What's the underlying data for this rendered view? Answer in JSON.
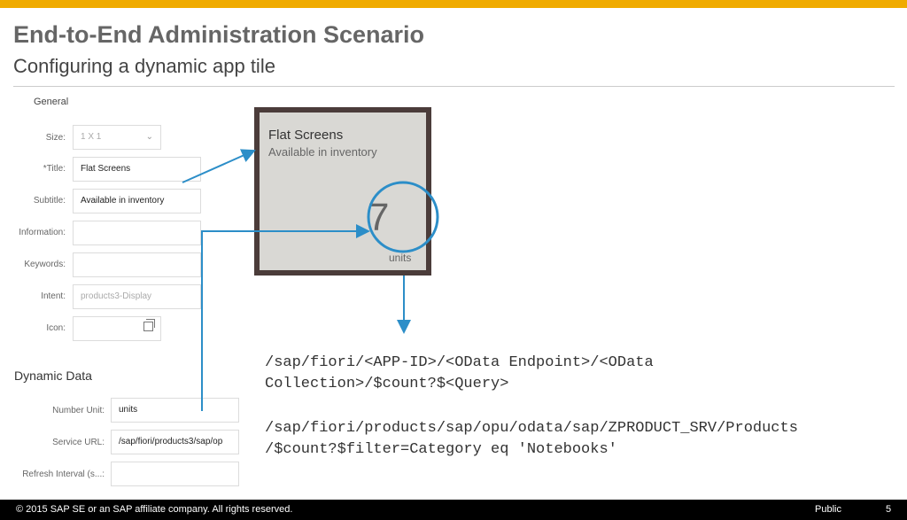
{
  "header": {
    "title": "End-to-End Administration Scenario",
    "subtitle": "Configuring a dynamic app tile"
  },
  "form": {
    "general_title": "General",
    "size_label": "Size:",
    "size_value": "1 X 1",
    "title_label": "*Title:",
    "title_value": "Flat Screens",
    "subtitle_label": "Subtitle:",
    "subtitle_value": "Available in inventory",
    "information_label": "Information:",
    "keywords_label": "Keywords:",
    "intent_label": "Intent:",
    "intent_value": "products3-Display",
    "icon_label": "Icon:",
    "dynamic_title": "Dynamic Data",
    "number_unit_label": "Number Unit:",
    "number_unit_value": "units",
    "service_url_label": "Service URL:",
    "service_url_value": "/sap/fiori/products3/sap/op",
    "refresh_label": "Refresh Interval (s...:"
  },
  "tile": {
    "title": "Flat Screens",
    "subtitle": "Available in inventory",
    "number": "7",
    "unit": "units"
  },
  "code": {
    "line1": "/sap/fiori/<APP-ID>/<OData Endpoint>/<OData",
    "line2": "Collection>/$count?$<Query>",
    "line3": "/sap/fiori/products/sap/opu/odata/sap/ZPRODUCT_SRV/Products",
    "line4": "/$count?$filter=Category eq 'Notebooks'"
  },
  "footer": {
    "copyright": "© 2015 SAP SE or an SAP affiliate company. All rights reserved.",
    "classification": "Public",
    "page": "5"
  },
  "colors": {
    "accent_bar": "#f0ab00",
    "arrow": "#2c8ec8",
    "tile_frame": "#4b3c3a"
  }
}
